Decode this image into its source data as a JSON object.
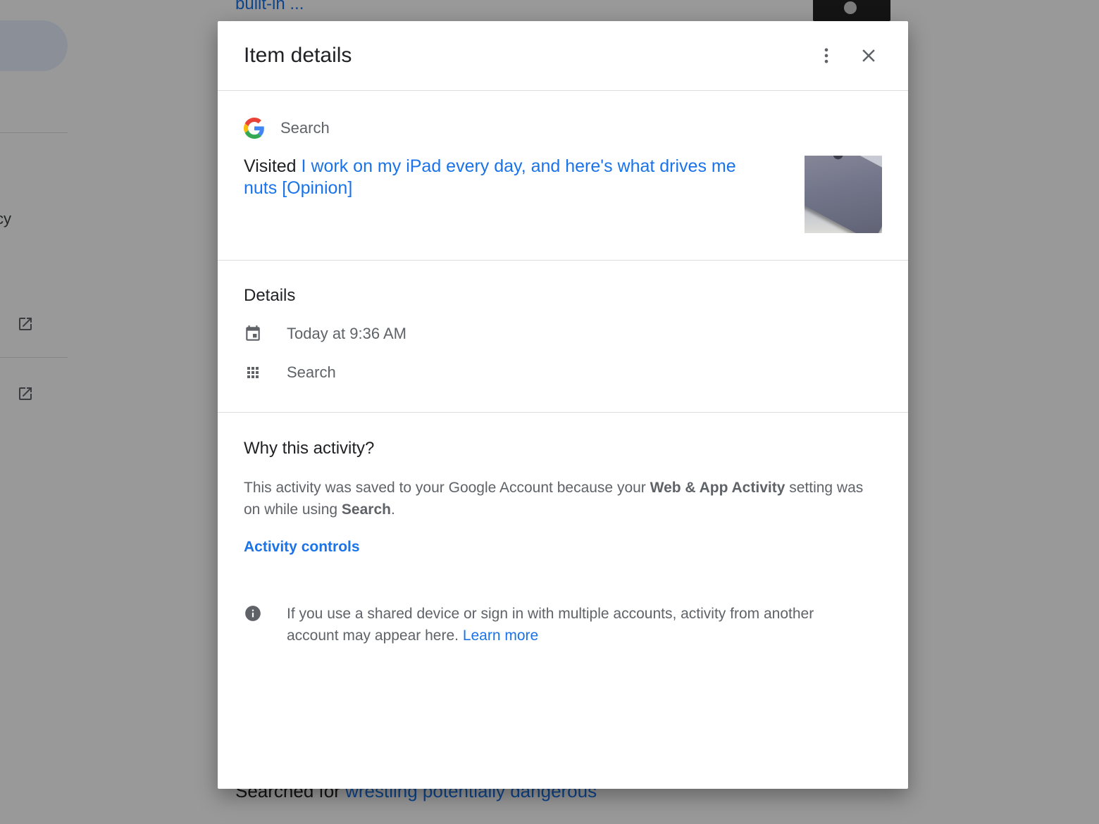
{
  "background": {
    "top_link": "built-in ...",
    "side_text": "cy",
    "bottom_prefix": "Searched for",
    "bottom_link": "wrestling potentially dangerous"
  },
  "dialog": {
    "title": "Item details",
    "more_icon": "more-vert-icon",
    "close_icon": "close-icon",
    "product": "Search",
    "visited_prefix": "Visited",
    "visited_link": "I work on my iPad every day, and here's what drives me nuts [Opinion]",
    "details": {
      "title": "Details",
      "time": "Today at 9:36 AM",
      "app": "Search"
    },
    "why": {
      "title": "Why this activity?",
      "text_1": "This activity was saved to your Google Account because your ",
      "setting_name": "Web & App Activity",
      "text_2": " setting was on while using ",
      "product": "Search",
      "text_3": ".",
      "controls_link": "Activity controls"
    },
    "info": {
      "text": "If you use a shared device or sign in with multiple accounts, activity from another account may appear here.",
      "learn_more": "Learn more"
    }
  },
  "colors": {
    "link": "#1a73e8",
    "secondary_text": "#5f6368",
    "divider": "#dadce0"
  }
}
